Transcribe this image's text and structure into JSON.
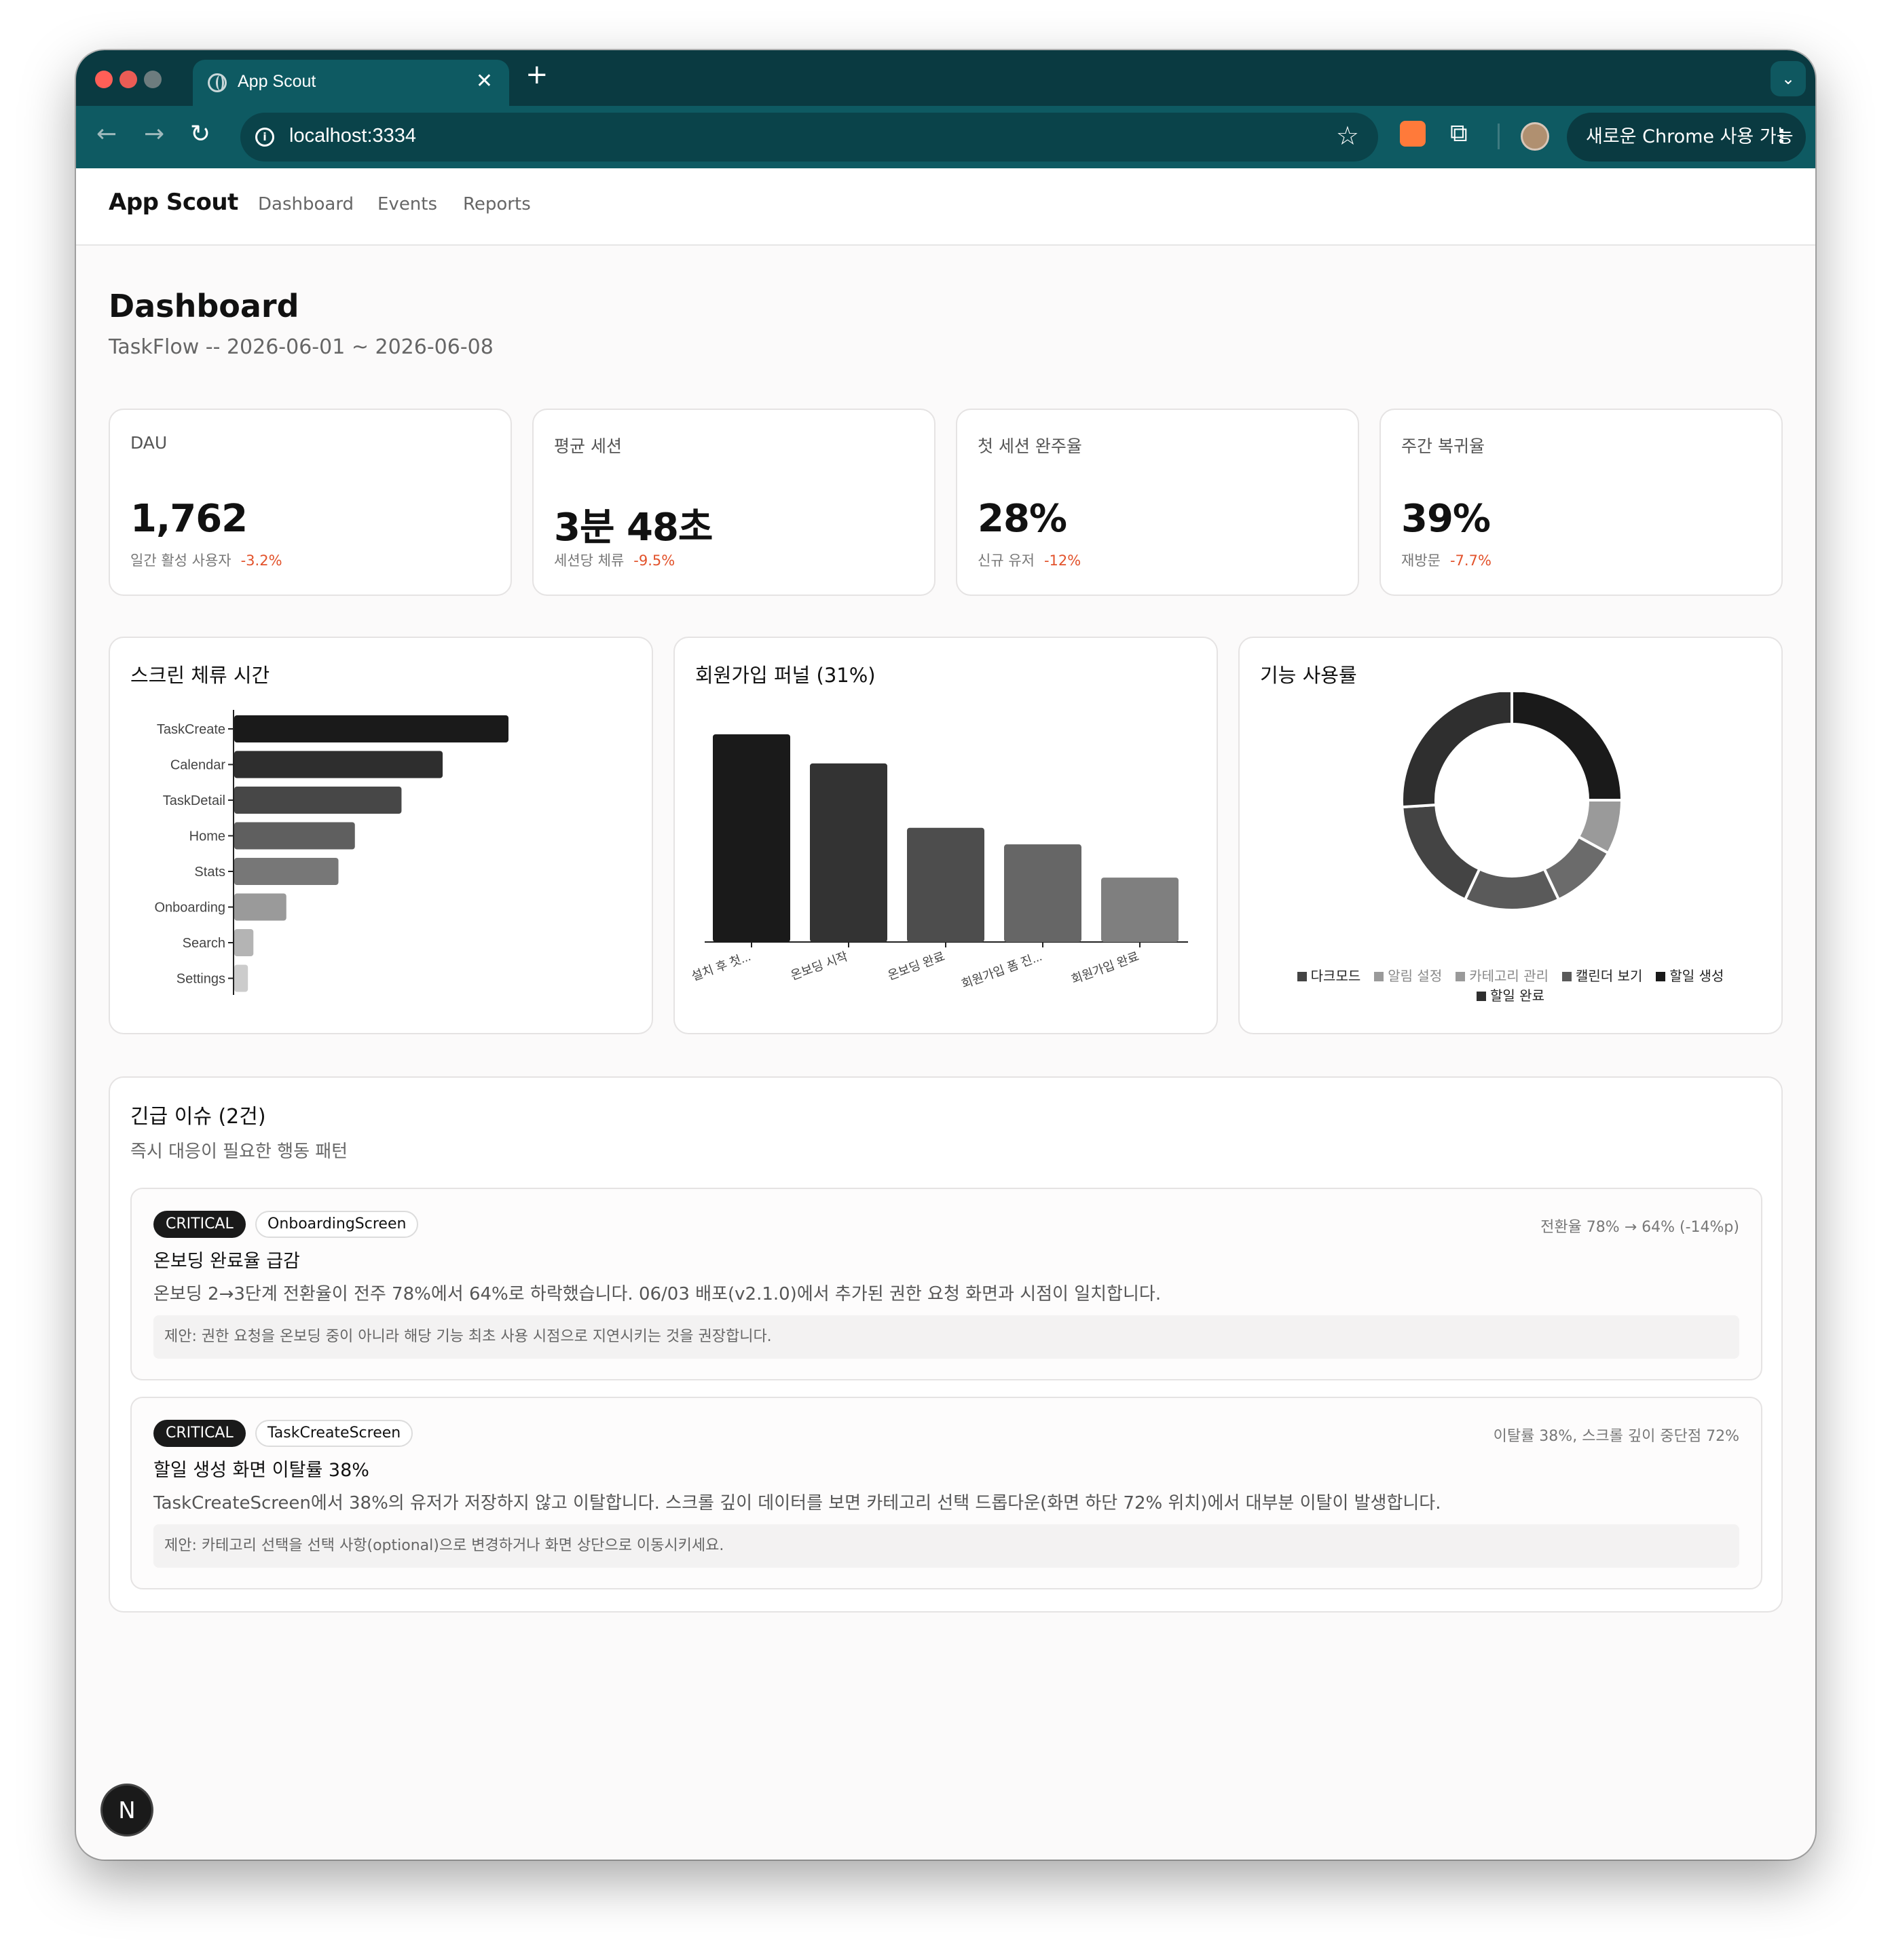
{
  "browser": {
    "tab_title": "App Scout",
    "url": "localhost:3334",
    "chrome_cta": "새로운 Chrome 사용 가능"
  },
  "app": {
    "brand": "App Scout",
    "nav": [
      "Dashboard",
      "Events",
      "Reports"
    ]
  },
  "header": {
    "title": "Dashboard",
    "subtitle": "TaskFlow -- 2026-06-01 ~ 2026-06-08"
  },
  "kpis": [
    {
      "label": "DAU",
      "value": "1,762",
      "caption": "일간 활성 사용자",
      "delta": "-3.2%"
    },
    {
      "label": "평균 세션",
      "value": "3분 48초",
      "caption": "세션당 체류",
      "delta": "-9.5%"
    },
    {
      "label": "첫 세션 완주율",
      "value": "28%",
      "caption": "신규 유저",
      "delta": "-12%"
    },
    {
      "label": "주간 복귀율",
      "value": "39%",
      "caption": "재방문",
      "delta": "-7.7%"
    }
  ],
  "colors": {
    "delta_negative": "#e2522b",
    "chrome_titlebar": "#0a3a41",
    "chrome_toolbar": "#0e5a62"
  },
  "chart_data": [
    {
      "type": "bar",
      "orientation": "horizontal",
      "title": "스크린 체류 시간",
      "categories": [
        "TaskCreate",
        "Calendar",
        "TaskDetail",
        "Home",
        "Stats",
        "Onboarding",
        "Search",
        "Settings"
      ],
      "values": [
        100,
        76,
        61,
        44,
        38,
        19,
        7,
        5
      ],
      "colors": [
        "#1a1a1a",
        "#2e2e2e",
        "#474747",
        "#5f5f5f",
        "#777777",
        "#9a9a9a",
        "#b4b4b4",
        "#cccccc"
      ],
      "xlabel": "",
      "ylabel": "",
      "grid": false
    },
    {
      "type": "bar",
      "title": "회원가입 퍼널 (31%)",
      "categories": [
        "설치 후 첫...",
        "온보딩 시작",
        "온보딩 완료",
        "회원가입 폼 진...",
        "회원가입 완료"
      ],
      "values": [
        100,
        86,
        55,
        47,
        31
      ],
      "colors": [
        "#1a1a1a",
        "#333333",
        "#4d4d4d",
        "#666666",
        "#7f7f7f"
      ],
      "xlabel": "",
      "ylabel": "",
      "grid": false
    },
    {
      "type": "pie",
      "donut": true,
      "title": "기능 사용률",
      "categories": [
        "할일 생성",
        "알림 설정",
        "카테고리 관리",
        "캘린더 보기",
        "다크모드",
        "할일 완료"
      ],
      "values": [
        25,
        8,
        10,
        14,
        17,
        26
      ],
      "colors": [
        "#1a1a1a",
        "#9a9a9a",
        "#6b6b6b",
        "#5a5a5a",
        "#444444",
        "#2f2f2f"
      ],
      "legend": [
        "다크모드",
        "알림 설정",
        "카테고리 관리",
        "캘린더 보기",
        "할일 생성",
        "할일 완료"
      ],
      "legend_colors": [
        "#444444",
        "#9a9a9a",
        "#9a9a9a",
        "#5a5a5a",
        "#1a1a1a",
        "#2f2f2f"
      ],
      "legend_placement": "bottom"
    }
  ],
  "issues": {
    "title": "긴급 이슈 (2건)",
    "subtitle": "즉시 대응이 필요한 행동 패턴",
    "items": [
      {
        "severity": "CRITICAL",
        "screen": "OnboardingScreen",
        "metric": "전환율 78% → 64% (-14%p)",
        "title": "온보딩 완료율 급감",
        "description": "온보딩 2→3단계 전환율이 전주 78%에서 64%로 하락했습니다. 06/03 배포(v2.1.0)에서 추가된 권한 요청 화면과 시점이 일치합니다.",
        "suggestion": "제안: 권한 요청을 온보딩 중이 아니라 해당 기능 최초 사용 시점으로 지연시키는 것을 권장합니다."
      },
      {
        "severity": "CRITICAL",
        "screen": "TaskCreateScreen",
        "metric": "이탈률 38%, 스크롤 깊이 중단점 72%",
        "title": "할일 생성 화면 이탈률 38%",
        "description": "TaskCreateScreen에서 38%의 유저가 저장하지 않고 이탈합니다. 스크롤 깊이 데이터를 보면 카테고리 선택 드롭다운(화면 하단 72% 위치)에서 대부분 이탈이 발생합니다.",
        "suggestion": "제안: 카테고리 선택을 선택 사항(optional)으로 변경하거나 화면 상단으로 이동시키세요."
      }
    ]
  },
  "dev_badge": "N"
}
